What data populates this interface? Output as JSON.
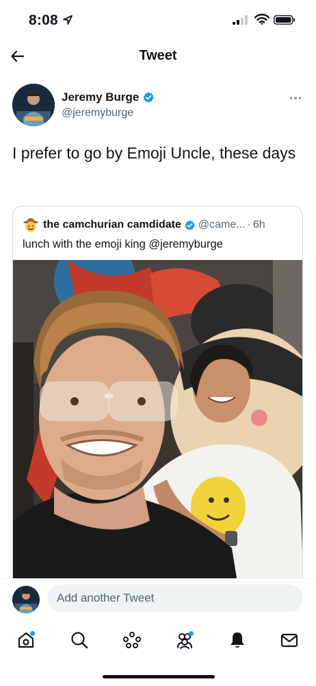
{
  "status_bar": {
    "time": "8:08"
  },
  "header": {
    "title": "Tweet"
  },
  "tweet": {
    "author_name": "Jeremy Burge",
    "author_handle": "@jeremyburge",
    "text": "I prefer to go by Emoji Uncle, these days"
  },
  "quote": {
    "author_name": "the camchurian camdidate",
    "author_handle": "@came...",
    "separator": "·",
    "time": "6h",
    "text": "lunch with the emoji king @jeremyburge"
  },
  "reply": {
    "placeholder": "Add another Tweet"
  },
  "tabs": [
    "home-icon",
    "search-icon",
    "spaces-icon",
    "communities-icon",
    "notifications-icon",
    "messages-icon"
  ],
  "colors": {
    "accent": "#1d9bf0",
    "text": "#0f1419",
    "secondary": "#536471"
  }
}
